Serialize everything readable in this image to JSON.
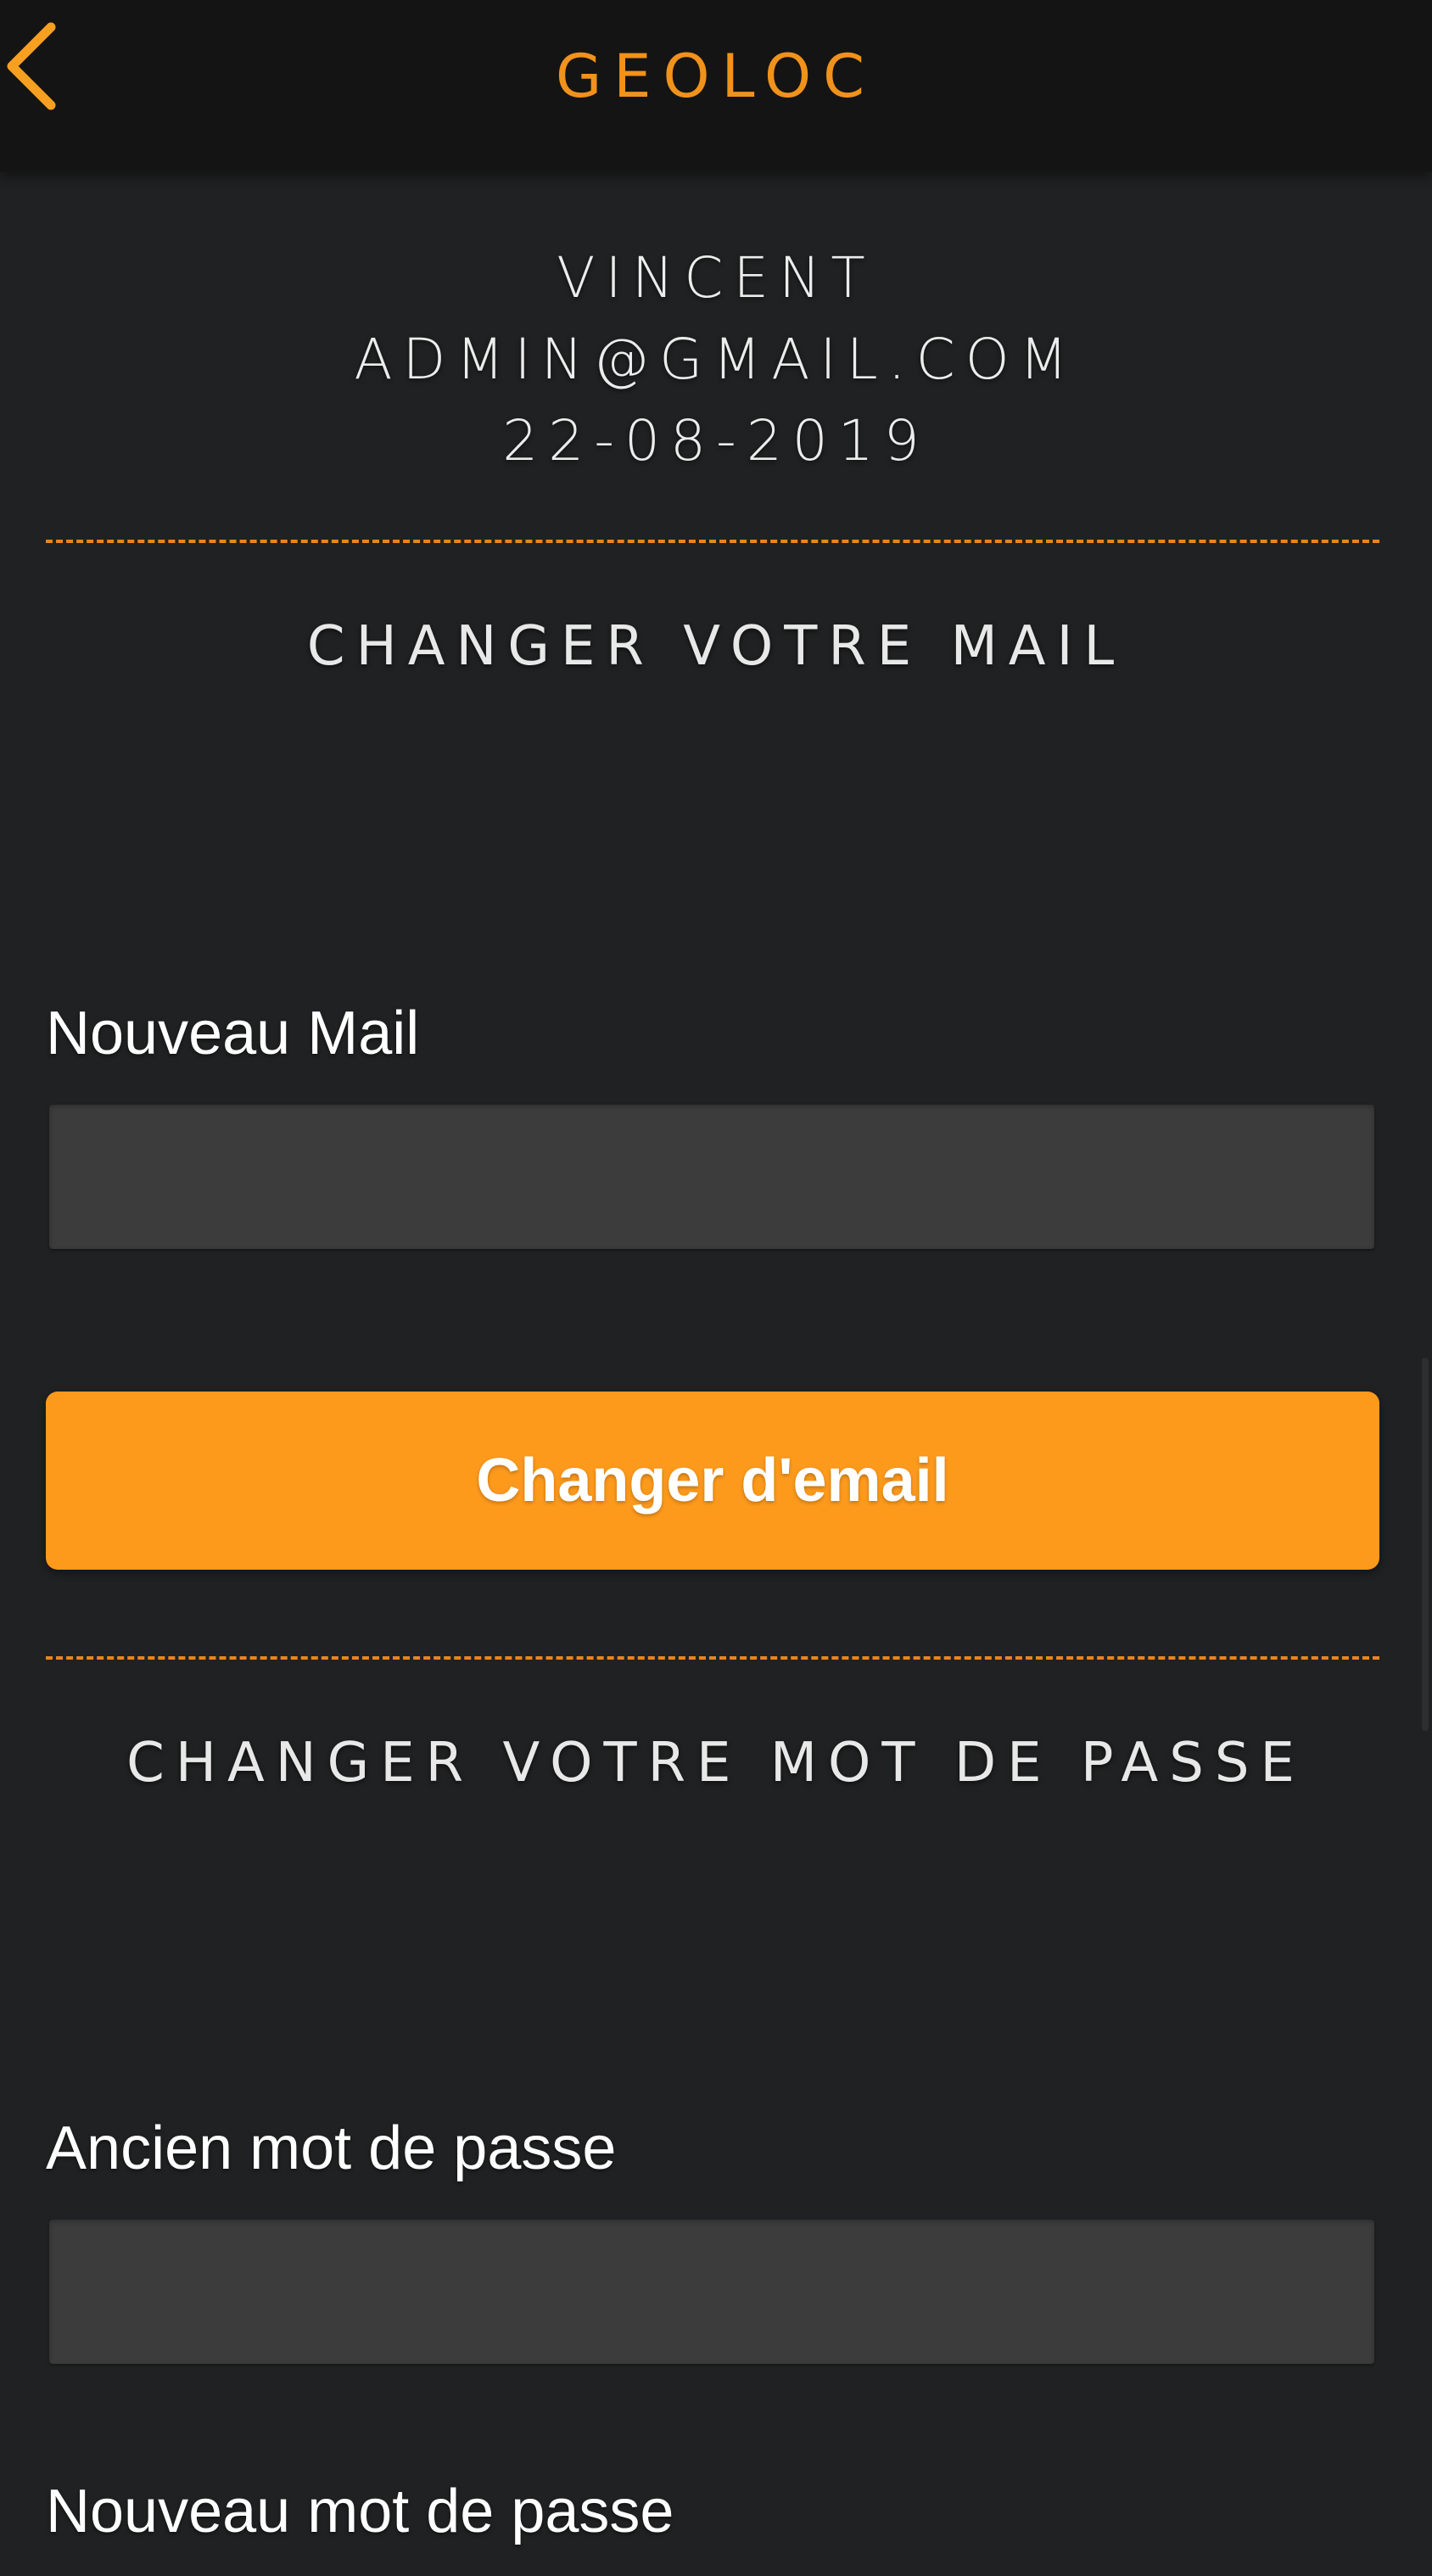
{
  "header": {
    "title": "GEOLOC",
    "back_icon": "arrow-left-icon",
    "accent_color": "#f0921c"
  },
  "user": {
    "name": "VINCENT",
    "email": "ADMIN@GMAIL.COM",
    "date": "22-08-2019"
  },
  "email_section": {
    "title": "CHANGER VOTRE MAIL",
    "new_mail_label": "Nouveau Mail",
    "new_mail_value": "",
    "submit_label": "Changer d'email",
    "button_color": "#fd9a1c"
  },
  "password_section": {
    "title": "CHANGER VOTRE MOT DE PASSE",
    "old_password_label": "Ancien mot de passe",
    "old_password_value": "",
    "new_password_label": "Nouveau mot de passe"
  }
}
